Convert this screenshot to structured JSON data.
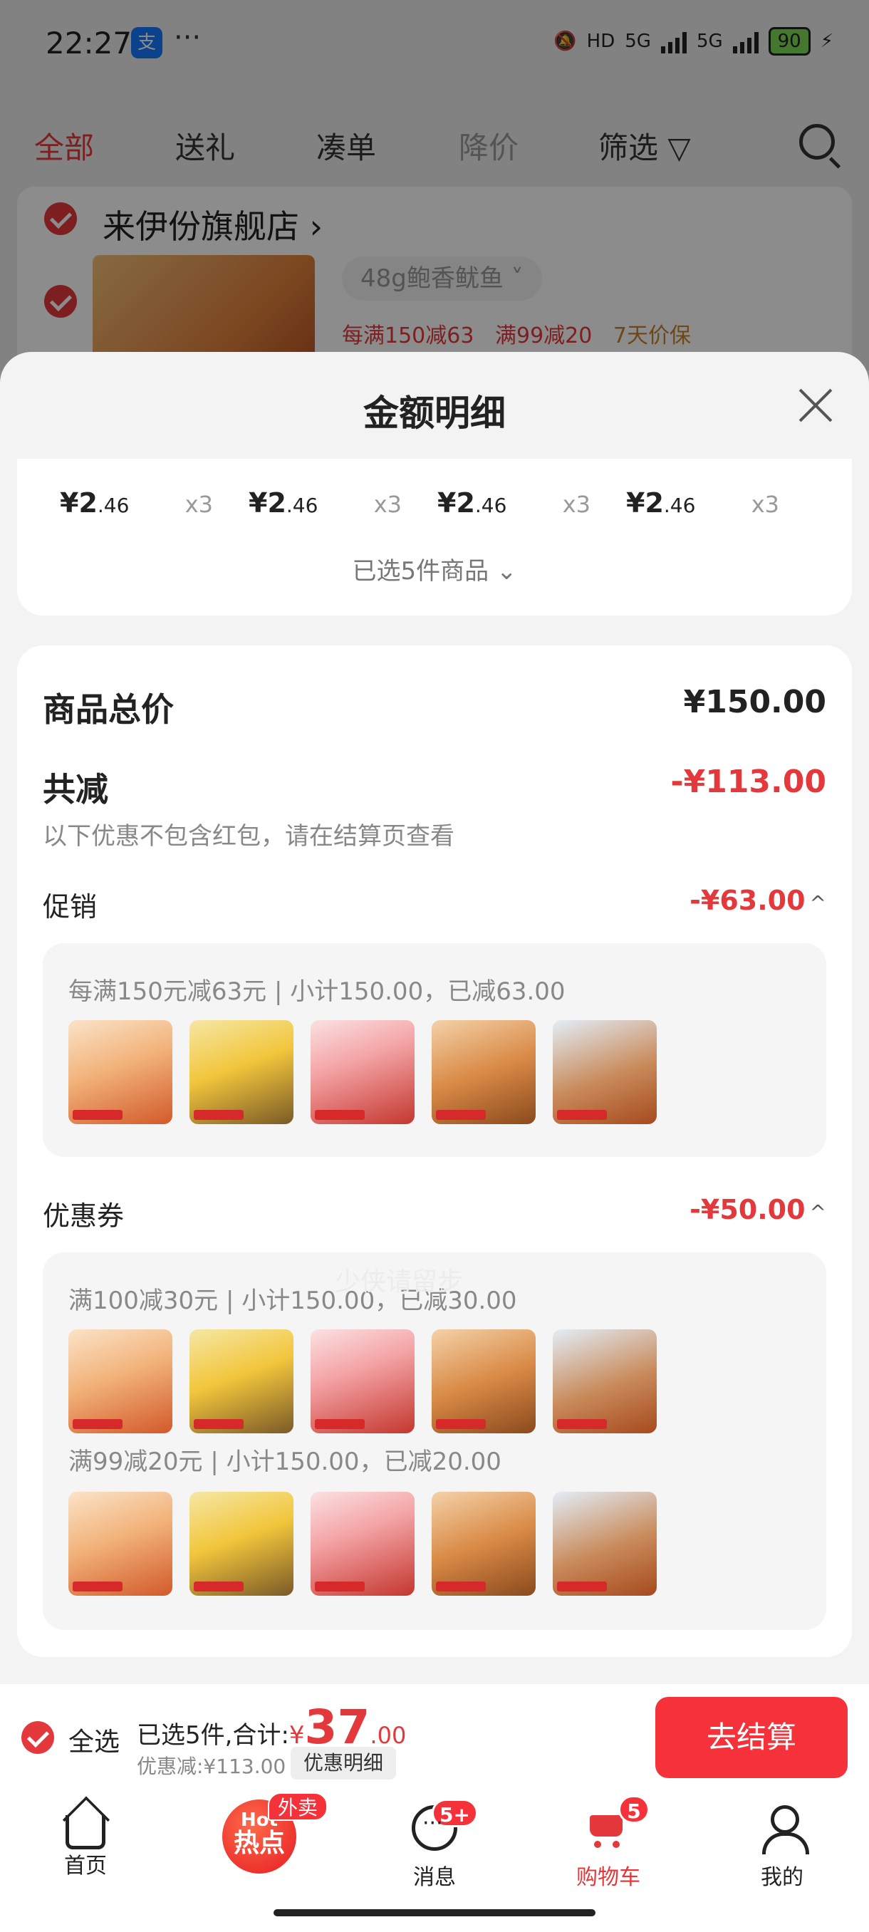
{
  "status_bar": {
    "time": "22:27",
    "dots": "···",
    "battery": "90",
    "net1": "HD",
    "net2": "5G",
    "net3": "5G"
  },
  "top_tabs": [
    "全部",
    "送礼",
    "凑单",
    "降价",
    "筛选"
  ],
  "shop": {
    "name": "来伊份旗舰店 ›",
    "sku": "48g鲍香鱿鱼 ˅",
    "promos": [
      "每满150减63",
      "满99减20"
    ],
    "price_protect": "7天价保"
  },
  "sheet": {
    "title": "金额明细",
    "items": [
      {
        "yen": "¥",
        "int": "2",
        "dec": ".46",
        "qty": "x3"
      },
      {
        "yen": "¥",
        "int": "2",
        "dec": ".46",
        "qty": "x3"
      },
      {
        "yen": "¥",
        "int": "2",
        "dec": ".46",
        "qty": "x3"
      },
      {
        "yen": "¥",
        "int": "2",
        "dec": ".46",
        "qty": "x3"
      }
    ],
    "selected_text": "已选5件商品 ⌄",
    "total_label": "商品总价",
    "total_value": "¥150.00",
    "discount_label": "共减",
    "discount_value": "-¥113.00",
    "discount_note": "以下优惠不包含红包，请在结算页查看",
    "promo": {
      "label": "促销",
      "value": "-¥63.00",
      "caret": "^",
      "rule": "每满150元减63元 | 小计150.00，已减63.00"
    },
    "coupon": {
      "label": "优惠券",
      "value": "-¥50.00",
      "caret": "^",
      "rule1": "满100减30元 | 小计150.00，已减30.00",
      "rule2": "满99减20元 | 小计150.00，已减20.00"
    },
    "watermark": "少侠请留步"
  },
  "checkout_bar": {
    "select_all": "全选",
    "summary_prefix": "已选5件,合计:",
    "yen": "¥",
    "amount_int": "37",
    "amount_dec": ".00",
    "saved": "优惠减:¥113.00",
    "detail_button": "优惠明细",
    "checkout_button": "去结算"
  },
  "tab_bar": {
    "home": "首页",
    "hot_top": "Hot",
    "hot_main": "热点",
    "hot_badge": "外卖",
    "messages": "消息",
    "messages_badge": "5+",
    "cart": "购物车",
    "cart_badge": "5",
    "me": "我的"
  },
  "colors": {
    "accent": "#e4393c",
    "button": "#f5313a",
    "sheet_bg": "#f3f3f3"
  }
}
